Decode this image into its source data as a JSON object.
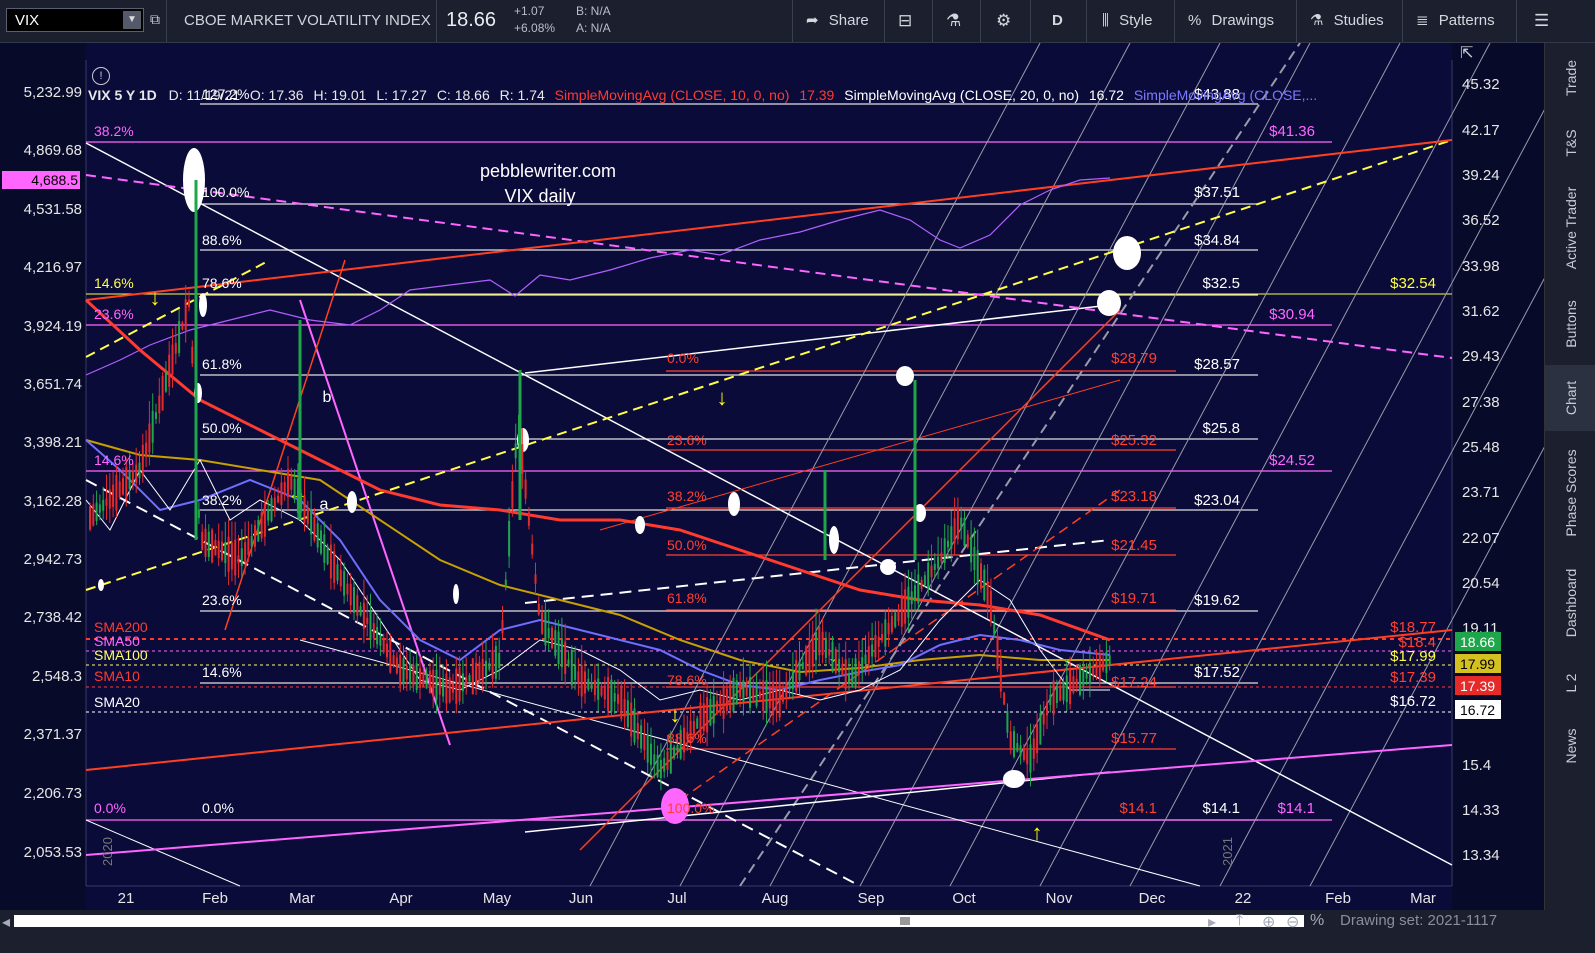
{
  "toolbar": {
    "symbol": "VIX",
    "description": "CBOE MARKET VOLATILITY INDEX",
    "last": "18.66",
    "change_abs": "+1.07",
    "change_pct": "+6.08%",
    "bid": "B: N/A",
    "ask": "A: N/A",
    "share": "Share",
    "period": "D",
    "style": "Style",
    "drawings": "Drawings",
    "studies": "Studies",
    "patterns": "Patterns"
  },
  "header": {
    "title": "VIX 5 Y 1D",
    "date": "D: 11/19/21",
    "open": "O: 17.36",
    "high": "H: 19.01",
    "low": "L: 17.27",
    "close": "C: 18.66",
    "range": "R: 1.74",
    "sma10": "SimpleMovingAvg (CLOSE, 10, 0, no)",
    "sma10_val": "17.39",
    "sma20": "SimpleMovingAvg (CLOSE, 20, 0, no)",
    "sma20_val": "16.72",
    "sma_other": "SimpleMovingAvg (CLOSE,..."
  },
  "watermark": {
    "line1": "pebblewriter.com",
    "line2": "VIX daily"
  },
  "left_axis": [
    "5,232.99",
    "4,869.68",
    "4,531.58",
    "4,216.97",
    "3,924.19",
    "3,651.74",
    "3,398.21",
    "3,162.28",
    "2,942.73",
    "2,738.42",
    "2,548.3",
    "2,371.37",
    "2,206.73",
    "2,053.53"
  ],
  "left_flag": "4,688.5",
  "right_axis": [
    "45.32",
    "42.17",
    "39.24",
    "36.52",
    "33.98",
    "31.62",
    "29.43",
    "27.38",
    "25.48",
    "23.71",
    "22.07",
    "20.54",
    "19.11",
    "17.99",
    "15.4",
    "14.33",
    "13.34"
  ],
  "right_flags": [
    {
      "text": "18.66",
      "color": "#1fa64a",
      "fg": "#ffffff"
    },
    {
      "text": "17.99",
      "color": "#d4c020",
      "fg": "#000000"
    },
    {
      "text": "17.39",
      "color": "#e52a2a",
      "fg": "#ffffff"
    },
    {
      "text": "16.72",
      "color": "#ffffff",
      "fg": "#000000"
    }
  ],
  "x_axis": [
    "21",
    "Feb",
    "Mar",
    "Apr",
    "May",
    "Jun",
    "Jul",
    "Aug",
    "Sep",
    "Oct",
    "Nov",
    "Dec",
    "22",
    "Feb",
    "Mar"
  ],
  "year_marks": [
    "2020",
    "2021"
  ],
  "sma_labels": [
    {
      "text": "SMA200",
      "color": "#ff3b2f"
    },
    {
      "text": "SMA50",
      "color": "#ff66ff"
    },
    {
      "text": "SMA100",
      "color": "#ffff66"
    },
    {
      "text": "SMA10",
      "color": "#ff3b2f"
    },
    {
      "text": "SMA20",
      "color": "#ffffff"
    }
  ],
  "fib_white_left": [
    "127.2%",
    "100.0%",
    "88.6%",
    "78.6%",
    "61.8%",
    "50.0%",
    "38.2%",
    "23.6%",
    "14.6%",
    "0.0%"
  ],
  "fib_magenta_left": [
    "38.2%",
    "23.6%",
    "14.6%",
    "0.0%"
  ],
  "fib_yellow_left": "14.6%",
  "fib_red_mid": [
    "0.0%",
    "23.6%",
    "38.2%",
    "50.0%",
    "61.8%",
    "78.6%",
    "88.6%",
    "100.0%"
  ],
  "white_levels": [
    "$43.88",
    "$37.51",
    "$34.84",
    "$32.5",
    "$28.57",
    "$25.8",
    "$23.04",
    "$19.62",
    "$17.52",
    "$14.1"
  ],
  "magenta_levels": [
    "$41.36",
    "$30.94",
    "$24.52",
    "$14.1"
  ],
  "yellow_levels": [
    "$32.54",
    "$17.99"
  ],
  "red_levels": [
    "$28.79",
    "$25.32",
    "$23.18",
    "$21.45",
    "$19.71",
    "$17.24",
    "$15.77",
    "$14.1",
    "$18.77",
    "$18.4",
    "$17.39"
  ],
  "white_sma20_label": "$16.72",
  "wave_labels": [
    "b",
    "a"
  ],
  "right_tabs": [
    "Trade",
    "T&S",
    "Active Trader",
    "Buttons",
    "Chart",
    "Phase Scores",
    "Dashboard",
    "L 2",
    "News"
  ],
  "bottom": {
    "drawing_set": "Drawing set: 2021-1117"
  },
  "colors": {
    "background": "#0b0b3a",
    "toolbar": "#1c1f2e",
    "price_up": "#1fa64a",
    "price_down": "#e52a2a",
    "sma200": "#ff3b2f",
    "sma50": "#6f6fff",
    "sma100": "#c8a000",
    "fib_magenta": "#ff66ff",
    "fib_yellow": "#ffff44"
  }
}
